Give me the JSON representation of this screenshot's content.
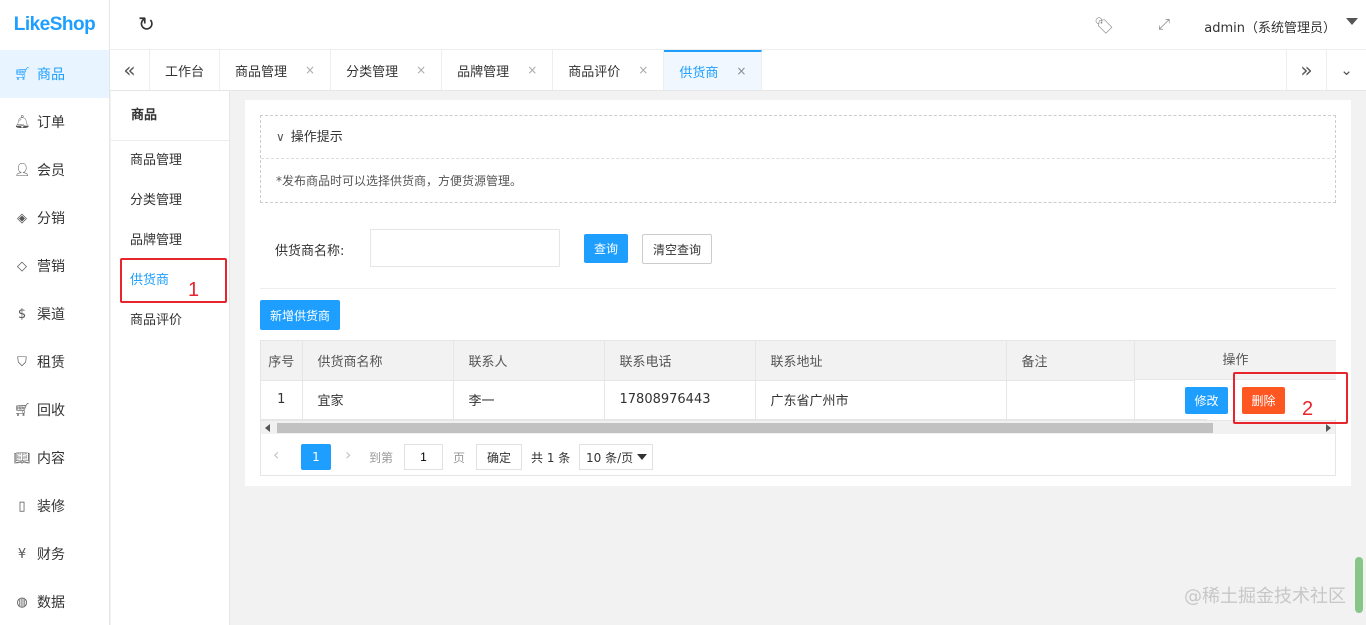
{
  "app": {
    "logo": "LikeShop"
  },
  "nav": [
    {
      "icon": "🛒︎",
      "label": "商品"
    },
    {
      "icon": "🔔︎",
      "label": "订单"
    },
    {
      "icon": "👤︎",
      "label": "会员"
    },
    {
      "icon": "◈",
      "label": "分销"
    },
    {
      "icon": "◇",
      "label": "营销"
    },
    {
      "icon": "$",
      "label": "渠道"
    },
    {
      "icon": "⛉",
      "label": "租赁"
    },
    {
      "icon": "🛒︎",
      "label": "回收"
    },
    {
      "icon": "📖︎",
      "label": "内容"
    },
    {
      "icon": "▯",
      "label": "装修"
    },
    {
      "icon": "¥",
      "label": "财务"
    },
    {
      "icon": "◍",
      "label": "数据"
    }
  ],
  "header": {
    "refresh_icon": "↻",
    "tag_icon": "🏷︎",
    "fullscreen_icon": "⤢",
    "user": "admin（系统管理员）"
  },
  "tabs": {
    "prev": "«",
    "next": "»",
    "down": "⌄",
    "close": "×",
    "items": [
      "工作台",
      "商品管理",
      "分类管理",
      "品牌管理",
      "商品评价",
      "供货商"
    ]
  },
  "submenu": {
    "title": "商品",
    "items": [
      "商品管理",
      "分类管理",
      "品牌管理",
      "供货商",
      "商品评价"
    ]
  },
  "annotations": {
    "one": "1",
    "two": "2"
  },
  "tips": {
    "title": "操作提示",
    "chevron": "∨",
    "text": "*发布商品时可以选择供货商，方便货源管理。"
  },
  "search": {
    "label": "供货商名称:",
    "value": "",
    "query_btn": "查询",
    "clear_btn": "清空查询"
  },
  "add_btn": "新增供货商",
  "table": {
    "headers": [
      "序号",
      "供货商名称",
      "联系人",
      "联系电话",
      "联系地址",
      "备注",
      "操作"
    ],
    "rows": [
      {
        "no": "1",
        "name": "宜家",
        "contact": "李一",
        "phone": "17808976443",
        "address": "广东省广州市",
        "note": "",
        "edit": "修改",
        "delete": "删除"
      }
    ]
  },
  "pager": {
    "prev": "‹",
    "next": "›",
    "current": "1",
    "goto": "到第",
    "page_value": "1",
    "page_unit": "页",
    "confirm": "确定",
    "total": "共 1 条",
    "size": "10 条/页"
  },
  "watermark": "@稀土掘金技术社区"
}
